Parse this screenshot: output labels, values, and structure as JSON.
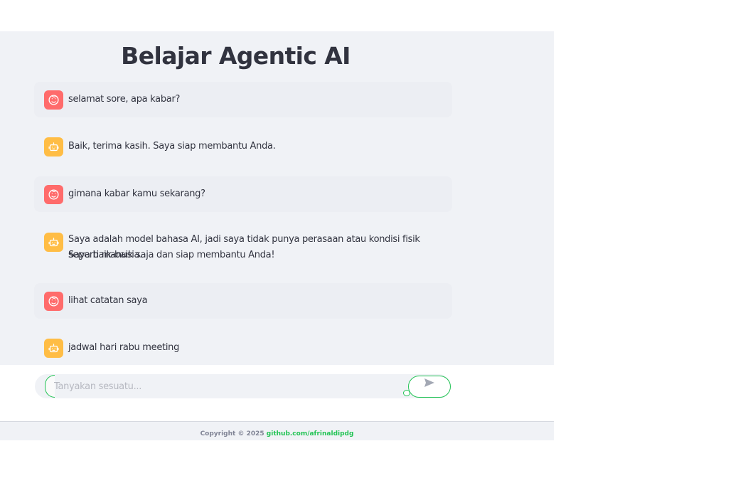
{
  "app": {
    "title": "Belajar Agentic AI"
  },
  "messages": [
    {
      "role": "user",
      "avatar_icon": "user-face-icon",
      "text": "selamat sore, apa kabar?"
    },
    {
      "role": "assistant",
      "avatar_icon": "robot-icon",
      "text": "Baik, terima kasih. Saya siap membantu Anda."
    },
    {
      "role": "user",
      "avatar_icon": "user-face-icon",
      "text": "gimana kabar kamu sekarang?"
    },
    {
      "role": "assistant",
      "avatar_icon": "robot-icon",
      "text_line1": "Saya adalah model bahasa AI, jadi saya tidak punya perasaan atau kondisi fisik seperti manusia.",
      "text_line2": "Saya baik-baik saja dan siap membantu Anda!"
    },
    {
      "role": "user",
      "avatar_icon": "user-face-icon",
      "text": "lihat catatan saya"
    },
    {
      "role": "assistant",
      "avatar_icon": "robot-icon",
      "text": "jadwal hari rabu meeting"
    }
  ],
  "chat_input": {
    "placeholder": "Tanyakan sesuatu...",
    "value": "",
    "send_icon": "send-arrow-icon"
  },
  "footer": {
    "copyright": "Copyright © 2025",
    "link_text": "github.com/afrinaldipdg"
  },
  "colors": {
    "accent": "#21c354",
    "user_avatar": "#ff6b6b",
    "assistant_avatar": "#ffbd45",
    "background": "#f0f2f6"
  }
}
